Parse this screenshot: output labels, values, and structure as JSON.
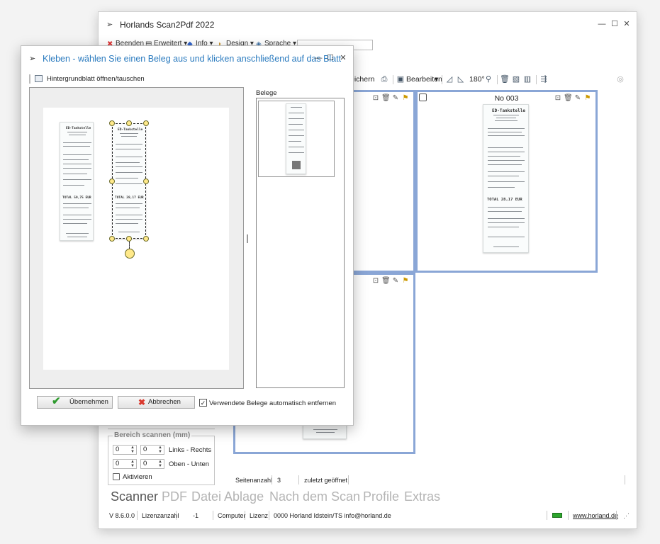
{
  "main_window": {
    "title": "Horlands Scan2Pdf 2022",
    "menu": [
      "Beenden",
      "Erweitert",
      "Info",
      "Design",
      "Sprache"
    ],
    "toolbar": {
      "save_partial": "eichern",
      "edit": "Bearbeiten",
      "rotate": "180°"
    },
    "panels": [
      {
        "title": ""
      },
      {
        "title": "No 003"
      },
      {
        "title": ""
      }
    ],
    "scan_area": {
      "label": "Bereich scannen (mm)",
      "row1": {
        "a": "0",
        "b": "0",
        "label": "Links - Rechts"
      },
      "row2": {
        "a": "0",
        "b": "0",
        "label": "Oben - Unten"
      },
      "activate": "Aktivieren"
    },
    "status_top": {
      "page_count_label": "Seitenanzahl",
      "page_count": "3",
      "last_opened": "zuletzt geöffnet"
    },
    "nav_tabs": [
      "Scanner",
      "PDF",
      "Datei Ablage",
      "Nach dem Scan",
      "Profile",
      "Extras"
    ],
    "status_bottom": {
      "version": "V 8.6.0.0",
      "license_label": "Lizenzanzahl",
      "license_value": "-1",
      "computer": "Computer",
      "license": "Lizenz",
      "owner": "0000 Horland Idstein/TS info@horland.de",
      "website": "www.horland.de"
    }
  },
  "dialog": {
    "title": "Kleben - wählen Sie einen Beleg aus und klicken anschließend auf das Blatt",
    "background_action": "Hintergrundblatt öffnen/tauschen",
    "belege_label": "Belege",
    "accept": "Übernehmen",
    "cancel": "Abbrechen",
    "auto_remove": "Verwendete Belege automatisch entfernen",
    "auto_remove_checked": true
  },
  "receipt": {
    "header": "ED-Tankstelle",
    "total_left": "TOTAL    59,75 EUR",
    "total_right": "TOTAL    28,17 EUR"
  },
  "colors": {
    "accent": "#2b7bbf",
    "panel_border": "#8aa6d6",
    "green_check": "#2e9a2e",
    "red_x": "#d9362b"
  }
}
